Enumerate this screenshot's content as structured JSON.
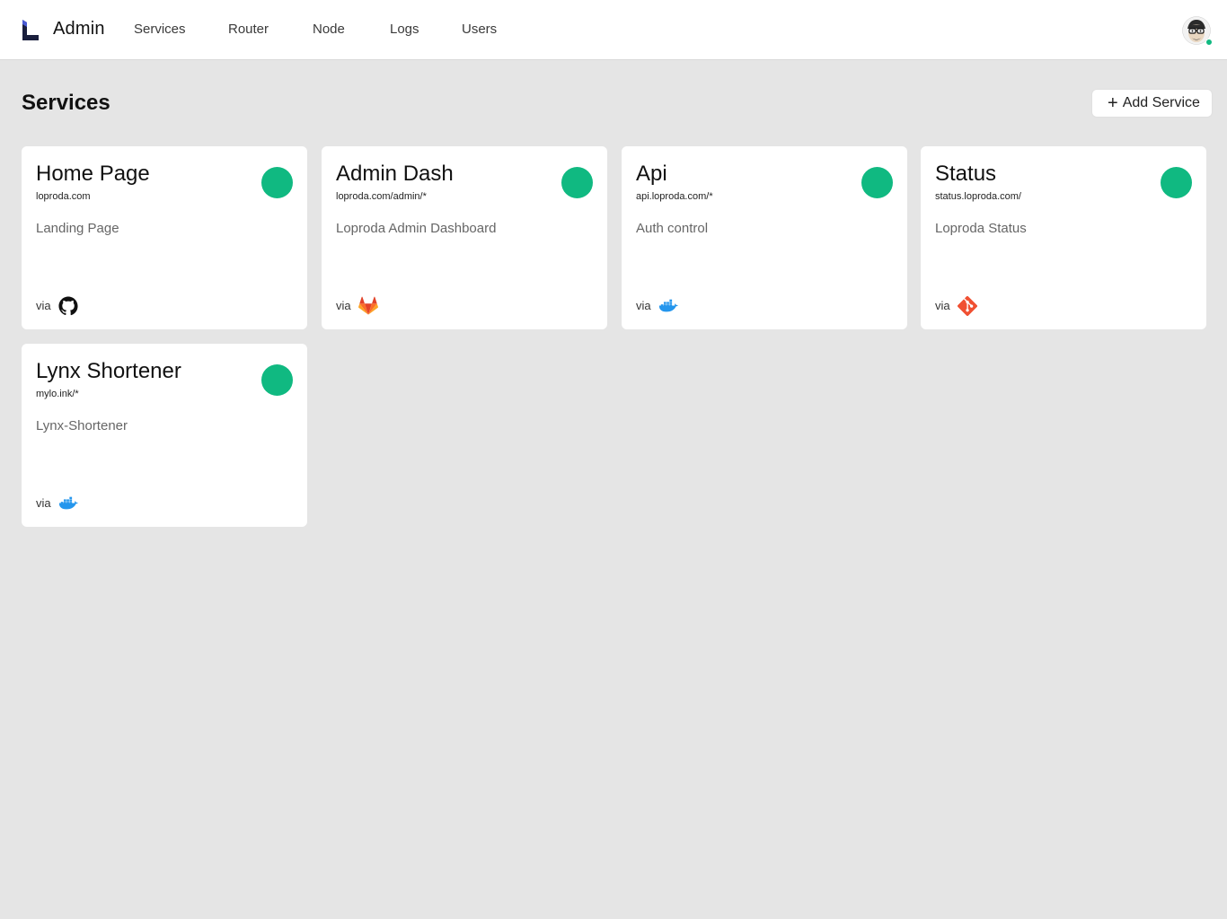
{
  "header": {
    "brand": "Admin",
    "nav": [
      {
        "label": "Services"
      },
      {
        "label": "Router"
      },
      {
        "label": "Node"
      },
      {
        "label": "Logs"
      },
      {
        "label": "Users"
      }
    ],
    "user_status_color": "#10b981"
  },
  "page": {
    "title": "Services",
    "add_button": {
      "icon": "plus-icon",
      "label": "Add Service"
    }
  },
  "services": [
    {
      "name": "Home Page",
      "url": "loproda.com",
      "description": "Landing Page",
      "via_label": "via",
      "source_icon": "github-icon",
      "status": "online"
    },
    {
      "name": "Admin Dash",
      "url": "loproda.com/admin/*",
      "description": "Loproda Admin Dashboard",
      "via_label": "via",
      "source_icon": "gitlab-icon",
      "status": "online"
    },
    {
      "name": "Api",
      "url": "api.loproda.com/*",
      "description": "Auth control",
      "via_label": "via",
      "source_icon": "docker-icon",
      "status": "online"
    },
    {
      "name": "Status",
      "url": "status.loproda.com/",
      "description": "Loproda Status",
      "via_label": "via",
      "source_icon": "git-icon",
      "status": "online"
    },
    {
      "name": "Lynx Shortener",
      "url": "mylo.ink/*",
      "description": "Lynx-Shortener",
      "via_label": "via",
      "source_icon": "docker-icon",
      "status": "online"
    }
  ],
  "colors": {
    "status_online": "#10b981",
    "background": "#e5e5e5",
    "github": "#111111",
    "gitlab": "#fc6d26",
    "docker": "#2496ed",
    "git": "#f05032"
  }
}
